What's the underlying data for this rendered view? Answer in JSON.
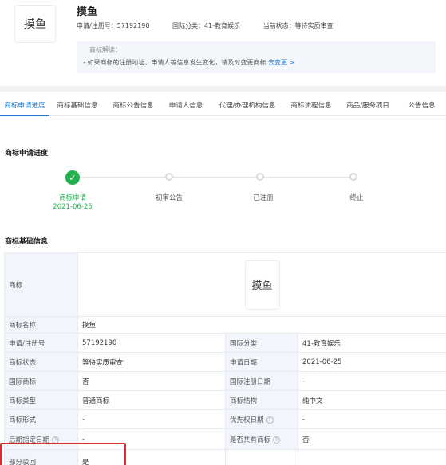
{
  "header": {
    "logo_text": "摸鱼",
    "name": "摸鱼",
    "reg_no": "申请/注册号：57192190",
    "intl_class": "国际分类：41-教育娱乐",
    "status": "当前状态：等待实质审查",
    "interp_title": "商标解读：",
    "interp_text": "- 如果商标的注册地址、申请人等信息发生变化，请及时变更商标",
    "interp_link": "去变更 >"
  },
  "tabs": [
    {
      "label": "商标申请进度"
    },
    {
      "label": "商标基础信息"
    },
    {
      "label": "商标公告信息"
    },
    {
      "label": "申请人信息"
    },
    {
      "label": "代理/办理机构信息"
    },
    {
      "label": "商标流程信息"
    },
    {
      "label": "商品/服务项目"
    },
    {
      "label": "公告信息"
    }
  ],
  "progress": {
    "title": "商标申请进度",
    "steps": [
      {
        "label": "商标申请",
        "date": "2021-06-25"
      },
      {
        "label": "初审公告"
      },
      {
        "label": "已注册"
      },
      {
        "label": "终止"
      }
    ]
  },
  "basic": {
    "title": "商标基础信息",
    "image_label": "商标",
    "image_text": "摸鱼",
    "rows": [
      {
        "l1": "商标名称",
        "v1": "摸鱼",
        "l2": "",
        "v2": ""
      },
      {
        "l1": "申请/注册号",
        "v1": "57192190",
        "l2": "国际分类",
        "v2": "41-教育娱乐"
      },
      {
        "l1": "商标状态",
        "v1": "等待实质审查",
        "l2": "申请日期",
        "v2": "2021-06-25"
      },
      {
        "l1": "国际商标",
        "v1": "否",
        "l2": "国际注册日期",
        "v2": "-"
      },
      {
        "l1": "商标类型",
        "v1": "普通商标",
        "l2": "商标结构",
        "v2": "纯中文"
      },
      {
        "l1": "商标形式",
        "v1": "-",
        "l2": "优先权日期",
        "v2": "-"
      },
      {
        "l1": "后期指定日期",
        "v1": "-",
        "l2": "是否共有商标",
        "v2": "否"
      },
      {
        "l1": "部分驳回",
        "v1": "是",
        "l2": "",
        "v2": ""
      }
    ]
  },
  "colors": {
    "accent": "#1677d8",
    "success": "#23b14d",
    "highlight": "#e0282e"
  },
  "icons": {
    "check": "check-icon",
    "help": "help-circle-icon"
  }
}
